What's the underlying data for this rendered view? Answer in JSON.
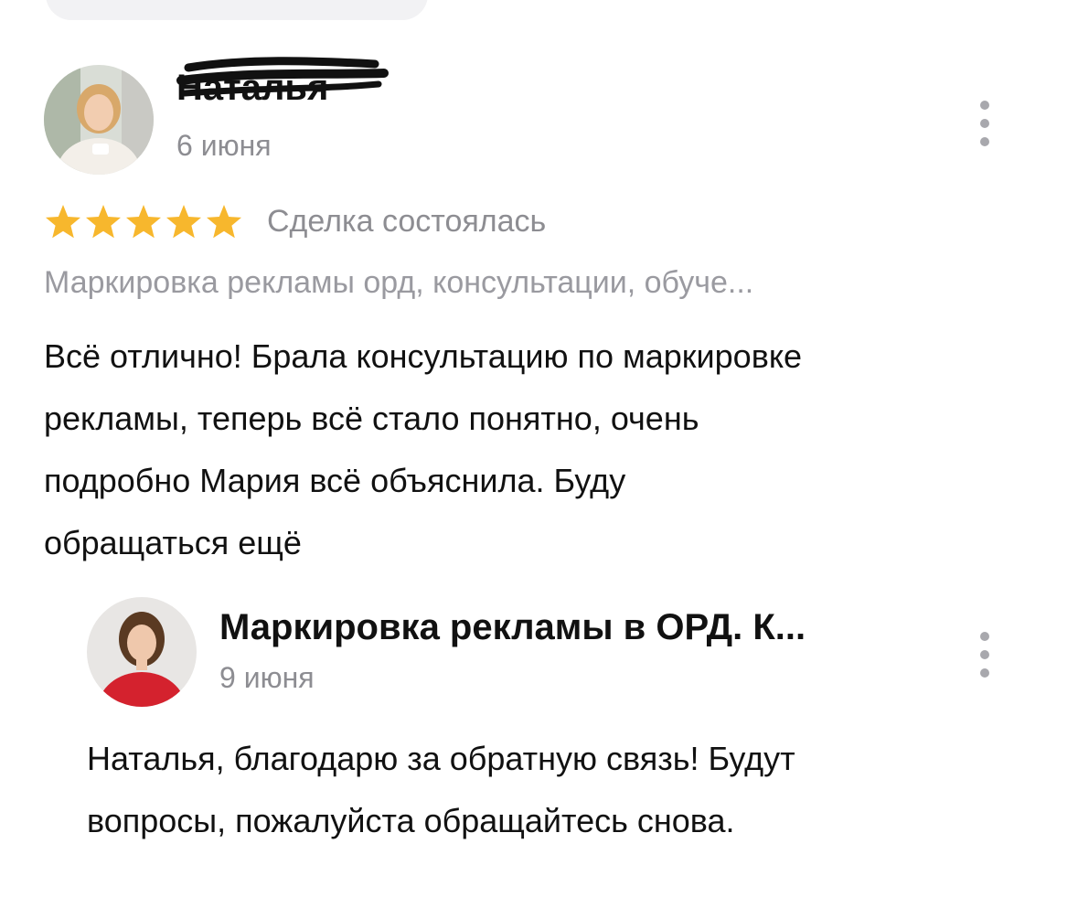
{
  "review": {
    "author_name": "Наталья",
    "date": "6 июня",
    "rating": 5,
    "status": "Сделка состоялась",
    "service": "Маркировка рекламы орд, консультации, обуче...",
    "text_lines": [
      "Всё отлично! Брала консультацию по маркировке",
      "рекламы, теперь всё стало понятно, очень",
      "подробно Мария всё объяснила. Буду",
      "обращаться ещё"
    ]
  },
  "reply": {
    "author_name": "Маркировка рекламы в ОРД. К...",
    "date": "9 июня",
    "text_lines": [
      "Наталья, благодарю за обратную связь! Будут",
      "вопросы, пожалуйста обращайтесь снова."
    ]
  },
  "icons": {
    "star": "star-icon",
    "more": "more-vertical-icon"
  },
  "colors": {
    "star": "#f7b72d",
    "secondary_text": "#8d8d92",
    "primary_text": "#111111"
  }
}
